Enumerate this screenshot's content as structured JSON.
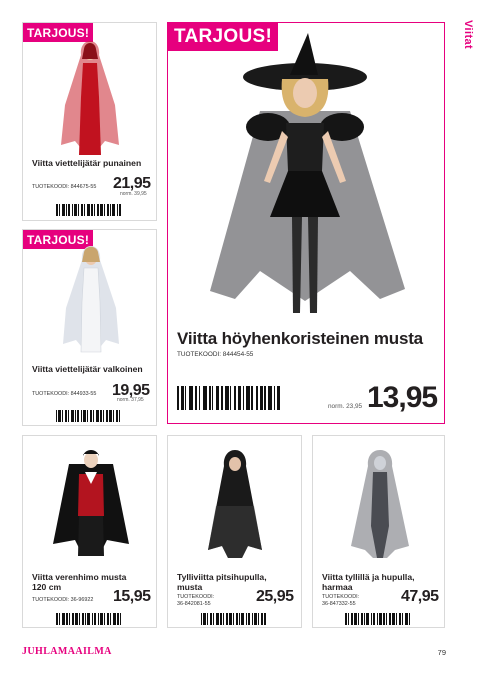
{
  "section_label": "Viitat",
  "footer": {
    "brand": "JUHLAMAAILMA",
    "page_number": "79"
  },
  "products": {
    "red": {
      "badge": "TARJOUS!",
      "name": "Viitta viettelijätär punainen",
      "code": "TUOTEKOODI: 844675-55",
      "price": "21,95",
      "norm": "norm. 39,95",
      "image": "red-cape-costume"
    },
    "white": {
      "badge": "TARJOUS!",
      "name": "Viitta viettelijätär valkoinen",
      "code": "TUOTEKOODI: 844933-55",
      "price": "19,95",
      "norm": "norm. 37,95",
      "image": "white-cape-costume"
    },
    "feather": {
      "badge": "TARJOUS!",
      "name": "Viitta höyhenkoristeinen musta",
      "code": "TUOTEKOODI: 844454-55",
      "price": "13,95",
      "norm": "norm. 23,95",
      "image": "black-feather-witch-costume"
    },
    "vampire": {
      "name_line1": "Viitta verenhimo musta",
      "name_line2": "120 cm",
      "code": "TUOTEKOODI: 36-96922",
      "price": "15,95",
      "image": "vampire-cape-costume"
    },
    "lace": {
      "name_line1": "Tylliviitta pitsihupulla,",
      "name_line2": "musta",
      "code_line1": "TUOTEKOODI:",
      "code_line2": "36-842081-55",
      "price": "25,95",
      "image": "black-lace-hood-cape-costume"
    },
    "grey": {
      "name_line1": "Viitta tyllillä ja hupulla,",
      "name_line2": "harmaa",
      "code_line1": "TUOTEKOODI:",
      "code_line2": "36-847332-55",
      "price": "47,95",
      "image": "grey-tulle-hood-cape-costume"
    }
  },
  "colors": {
    "accent": "#e6007e",
    "text": "#231f20",
    "border": "#d9d9d9"
  }
}
